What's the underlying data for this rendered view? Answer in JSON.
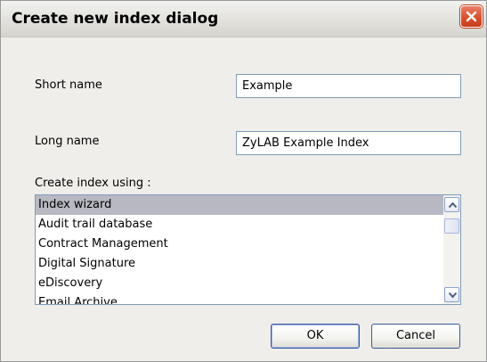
{
  "window": {
    "title": "Create new index dialog"
  },
  "form": {
    "short_name_label": "Short name",
    "short_name_value": "Example",
    "long_name_label": "Long name",
    "long_name_value": "ZyLAB Example Index",
    "create_using_label": "Create index using :"
  },
  "index_types": {
    "items": [
      "Index wizard",
      "Audit trail database",
      "Contract Management",
      "Digital Signature",
      "eDiscovery",
      "Email Archive"
    ],
    "selected": "Index wizard"
  },
  "buttons": {
    "ok_label": "OK",
    "cancel_label": "Cancel"
  },
  "icons": {
    "close": "close-icon",
    "scroll_up": "chevron-up-icon",
    "scroll_down": "chevron-down-icon"
  },
  "colors": {
    "dialog_background": "#efeeeb",
    "selection": "#b8b8c2",
    "close_button": "#d8502e",
    "field_border": "#7f9db9"
  }
}
